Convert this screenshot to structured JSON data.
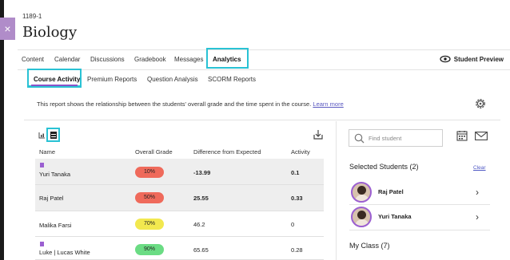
{
  "course": {
    "id": "1189-1",
    "title": "Biology"
  },
  "side_tab": {
    "glyph": "×"
  },
  "nav": {
    "items": [
      {
        "label": "Content",
        "active": false
      },
      {
        "label": "Calendar",
        "active": false
      },
      {
        "label": "Discussions",
        "active": false
      },
      {
        "label": "Gradebook",
        "active": false
      },
      {
        "label": "Messages",
        "active": false
      },
      {
        "label": "Analytics",
        "active": true
      }
    ],
    "student_preview": "Student Preview"
  },
  "subnav": {
    "items": [
      {
        "label": "Course Activity",
        "active": true
      },
      {
        "label": "Premium Reports",
        "active": false
      },
      {
        "label": "Question Analysis",
        "active": false
      },
      {
        "label": "SCORM Reports",
        "active": false
      }
    ]
  },
  "description": {
    "text": "This report shows the relationship between the students' overall grade and the time spent in the course.",
    "link": "Learn more"
  },
  "table": {
    "headers": {
      "name": "Name",
      "grade": "Overall Grade",
      "diff": "Difference from Expected",
      "activity": "Activity"
    },
    "rows": [
      {
        "name": "Yuri Tanaka",
        "grade": "10%",
        "grade_color": "#ef6a5b",
        "diff": "-13.99",
        "activity": "0.1",
        "bookmarked": true,
        "selected": true
      },
      {
        "name": "Raj Patel",
        "grade": "50%",
        "grade_color": "#ef6a5b",
        "diff": "25.55",
        "activity": "0.33",
        "bookmarked": false,
        "selected": true
      },
      {
        "name": "Malika Farsi",
        "grade": "70%",
        "grade_color": "#f2e84f",
        "diff": "46.2",
        "activity": "0",
        "bookmarked": false,
        "selected": false
      },
      {
        "name": "Luke | Lucas White",
        "grade": "90%",
        "grade_color": "#6bdc84",
        "diff": "65.65",
        "activity": "0.28",
        "bookmarked": true,
        "selected": false
      }
    ]
  },
  "sidebar": {
    "search_placeholder": "Find student",
    "selected_title": "Selected Students (2)",
    "clear_label": "Clear",
    "selected_students": [
      {
        "name": "Raj Patel"
      },
      {
        "name": "Yuri Tanaka"
      }
    ],
    "my_class_title": "My Class (7)"
  },
  "colors": {
    "accent_highlight": "#29c2d4",
    "purple": "#9b5fd1",
    "link": "#5a58c0"
  }
}
